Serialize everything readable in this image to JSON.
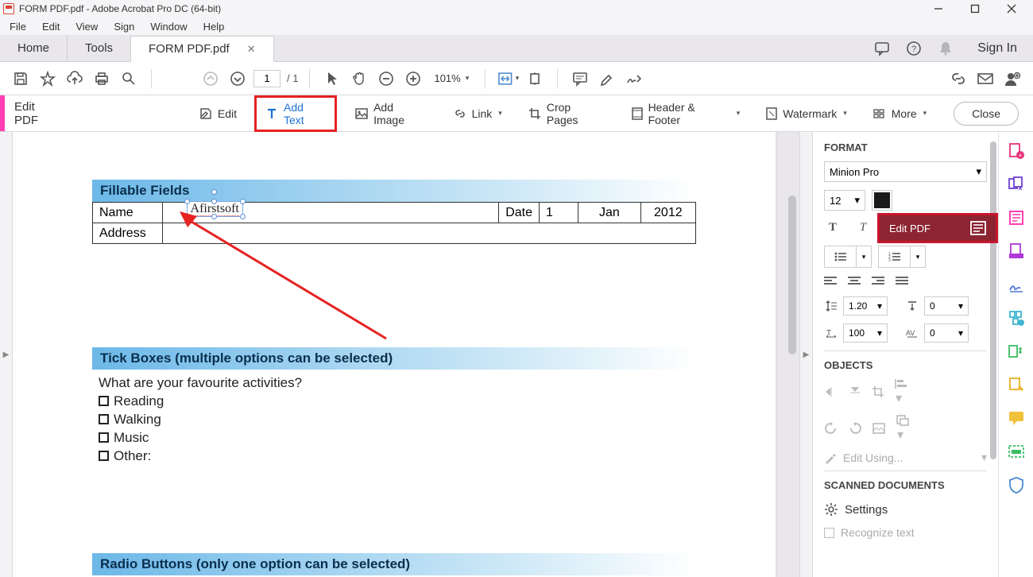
{
  "window": {
    "title": "FORM PDF.pdf - Adobe Acrobat Pro DC (64-bit)"
  },
  "menu": {
    "file": "File",
    "edit": "Edit",
    "view": "View",
    "sign": "Sign",
    "window": "Window",
    "help": "Help"
  },
  "tabs": {
    "home": "Home",
    "tools": "Tools",
    "doc": "FORM PDF.pdf",
    "signin": "Sign In"
  },
  "toolbar": {
    "page_current": "1",
    "page_total": "/  1",
    "zoom": "101%"
  },
  "editbar": {
    "title": "Edit PDF",
    "edit": "Edit",
    "add_text": "Add Text",
    "add_image": "Add Image",
    "link": "Link",
    "crop": "Crop Pages",
    "header_footer": "Header & Footer",
    "watermark": "Watermark",
    "more": "More",
    "close": "Close"
  },
  "doc": {
    "fillable_hdr": "Fillable Fields",
    "name_label": "Name",
    "name_value": "Afirstsoft",
    "date_label": "Date",
    "date_day": "1",
    "date_month": "Jan",
    "date_year": "2012",
    "address_label": "Address",
    "tick_hdr": "Tick Boxes (multiple options can be selected)",
    "activities_q": "What are your favourite activities?",
    "act1": "Reading",
    "act2": "Walking",
    "act3": "Music",
    "act4": "Other:",
    "radio_hdr": "Radio Buttons (only one option can be selected)"
  },
  "format": {
    "title": "FORMAT",
    "font": "Minion Pro",
    "size": "12",
    "line_spacing": "1.20",
    "para_spacing": "0",
    "hscale": "100",
    "char_spacing": "0",
    "objects_title": "OBJECTS",
    "edit_using": "Edit Using...",
    "scanned_title": "SCANNED DOCUMENTS",
    "settings": "Settings",
    "recognize": "Recognize text"
  },
  "tooltip": {
    "edit_pdf": "Edit PDF"
  }
}
